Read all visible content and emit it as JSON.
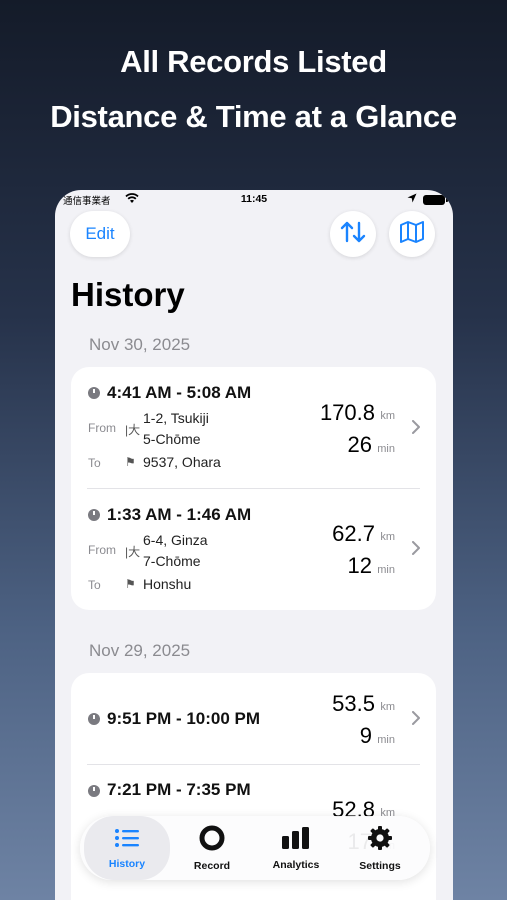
{
  "headline": {
    "line1": "All Records Listed",
    "line2": "Distance & Time at a Glance"
  },
  "status_bar": {
    "carrier": "通信事業者",
    "time": "11:45"
  },
  "toolbar": {
    "edit_label": "Edit"
  },
  "page": {
    "title": "History"
  },
  "sections": [
    {
      "date": "Nov 30, 2025",
      "records": [
        {
          "time_range": "4:41 AM - 5:08 AM",
          "from_label": "From",
          "from_line1": "1-2, Tsukiji",
          "from_line2": "5-Chōme",
          "to_label": "To",
          "to_place": "9537, Ohara",
          "distance": "170.8",
          "distance_unit": "km",
          "duration": "26",
          "duration_unit": "min"
        },
        {
          "time_range": "1:33 AM - 1:46 AM",
          "from_label": "From",
          "from_line1": "6-4, Ginza",
          "from_line2": "7-Chōme",
          "to_label": "To",
          "to_place": "Honshu",
          "distance": "62.7",
          "distance_unit": "km",
          "duration": "12",
          "duration_unit": "min"
        }
      ]
    },
    {
      "date": "Nov 29, 2025",
      "records": [
        {
          "time_range": "9:51 PM - 10:00 PM",
          "distance": "53.5",
          "distance_unit": "km",
          "duration": "9",
          "duration_unit": "min"
        },
        {
          "time_range": "7:21 PM - 7:35 PM",
          "distance": "52.8",
          "distance_unit": "km",
          "duration": "17",
          "duration_unit": "min"
        }
      ]
    }
  ],
  "tabs": [
    {
      "label": "History",
      "icon": "list-icon",
      "active": true
    },
    {
      "label": "Record",
      "icon": "record-icon",
      "active": false
    },
    {
      "label": "Analytics",
      "icon": "bar-chart-icon",
      "active": false
    },
    {
      "label": "Settings",
      "icon": "gear-icon",
      "active": false
    }
  ],
  "colors": {
    "accent": "#1a84ff",
    "background": "#f2f2f6",
    "secondary_text": "#8b8b90"
  }
}
